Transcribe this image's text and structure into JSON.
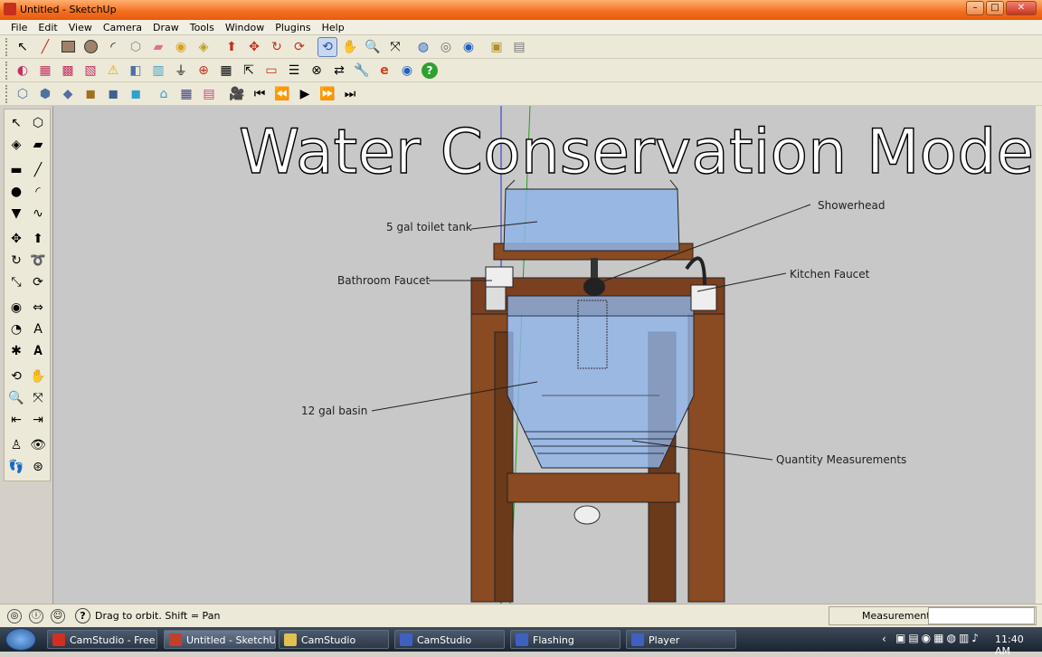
{
  "window": {
    "title": "Untitled - SketchUp"
  },
  "menu": [
    "File",
    "Edit",
    "View",
    "Camera",
    "Draw",
    "Tools",
    "Window",
    "Plugins",
    "Help"
  ],
  "model": {
    "heading": "Water Conservation Model",
    "labels": {
      "toilet_tank": "5 gal toilet tank",
      "showerhead": "Showerhead",
      "bathroom_faucet": "Bathroom Faucet",
      "kitchen_faucet": "Kitchen Faucet",
      "basin": "12 gal basin",
      "quantity": "Quantity Measurements"
    }
  },
  "status": {
    "hint": "Drag to orbit.  Shift = Pan",
    "measurements_label": "Measurements",
    "measurements_value": ""
  },
  "taskbar": {
    "tasks": [
      "CamStudio - Free Sc...",
      "Untitled - SketchUp",
      "CamStudio",
      "CamStudio",
      "Flashing",
      "Player"
    ],
    "clock": "11:40 AM"
  },
  "colors": {
    "titlebar": "#f36d1c",
    "canvas": "#c8c8c8",
    "wood": "#8a4a22",
    "water": "#8fb4e8"
  }
}
